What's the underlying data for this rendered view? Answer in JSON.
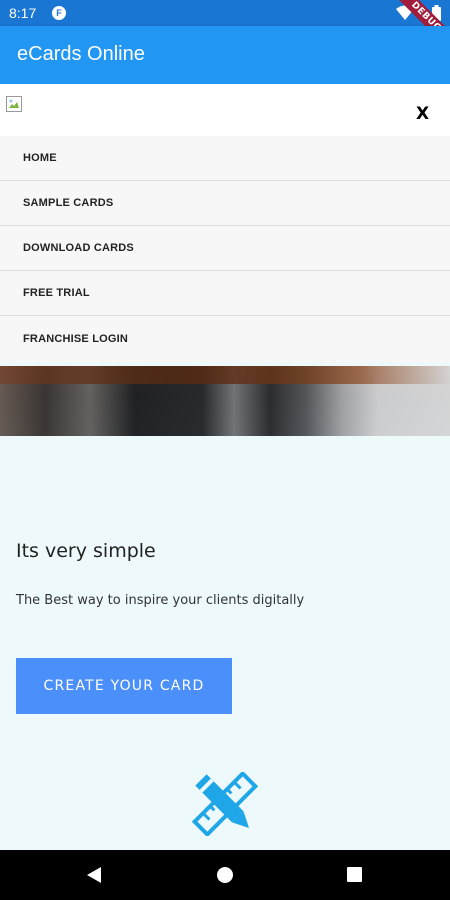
{
  "status_bar": {
    "time": "8:17",
    "app_icon": "flutter-app-icon",
    "debug_badge": "DEBUG",
    "icons": [
      "wifi-icon",
      "battery-icon"
    ]
  },
  "app_bar": {
    "title": "eCards Online",
    "color": "#2196f3"
  },
  "web_header": {
    "logo": "broken-image-icon",
    "close_label": "X"
  },
  "menu": {
    "items": [
      {
        "label": "HOME"
      },
      {
        "label": "SAMPLE CARDS"
      },
      {
        "label": "DOWNLOAD CARDS"
      },
      {
        "label": "FREE TRIAL"
      },
      {
        "label": "FRANCHISE LOGIN"
      }
    ]
  },
  "hero": {
    "heading": "Its very simple",
    "subtext": "The Best way to inspire your clients digitally",
    "cta_label": "CREATE YOUR CARD",
    "cta_color": "#4a8ffa",
    "icon": "pencil-ruler-icon",
    "icon_color": "#1ea6e8"
  },
  "nav_bar": {
    "icons": [
      "back-icon",
      "home-icon",
      "recents-icon"
    ]
  }
}
